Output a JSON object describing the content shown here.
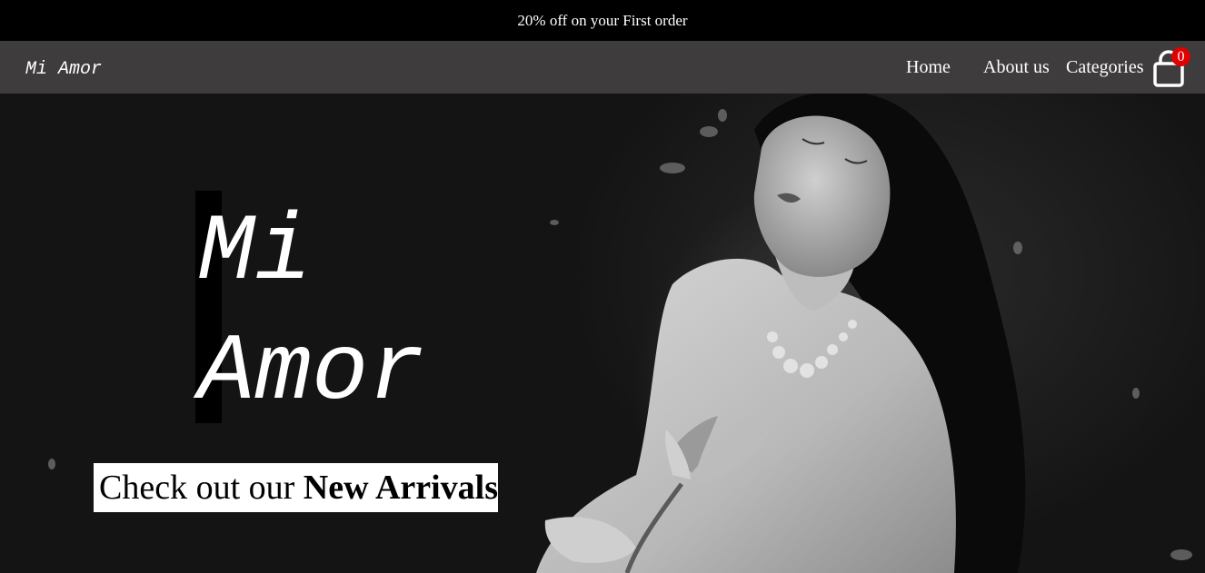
{
  "promo": {
    "text": "20% off on your First order"
  },
  "navbar": {
    "brand": "Mi Amor",
    "links": [
      {
        "label": "Home"
      },
      {
        "label": "About us"
      },
      {
        "label": "Categories"
      }
    ],
    "cart": {
      "icon": "shopping-bag-icon",
      "count": "0",
      "badge_color": "#e00000"
    }
  },
  "hero": {
    "title_line1": "Mi",
    "title_line2": "Amor",
    "cta_prefix": "Check out our ",
    "cta_emphasis": "New Arrivals",
    "image": "black-and-white-photo-woman-holding-lotus"
  },
  "colors": {
    "promo_bg": "#000000",
    "navbar_bg": "#3e3c3d",
    "text": "#ffffff"
  }
}
